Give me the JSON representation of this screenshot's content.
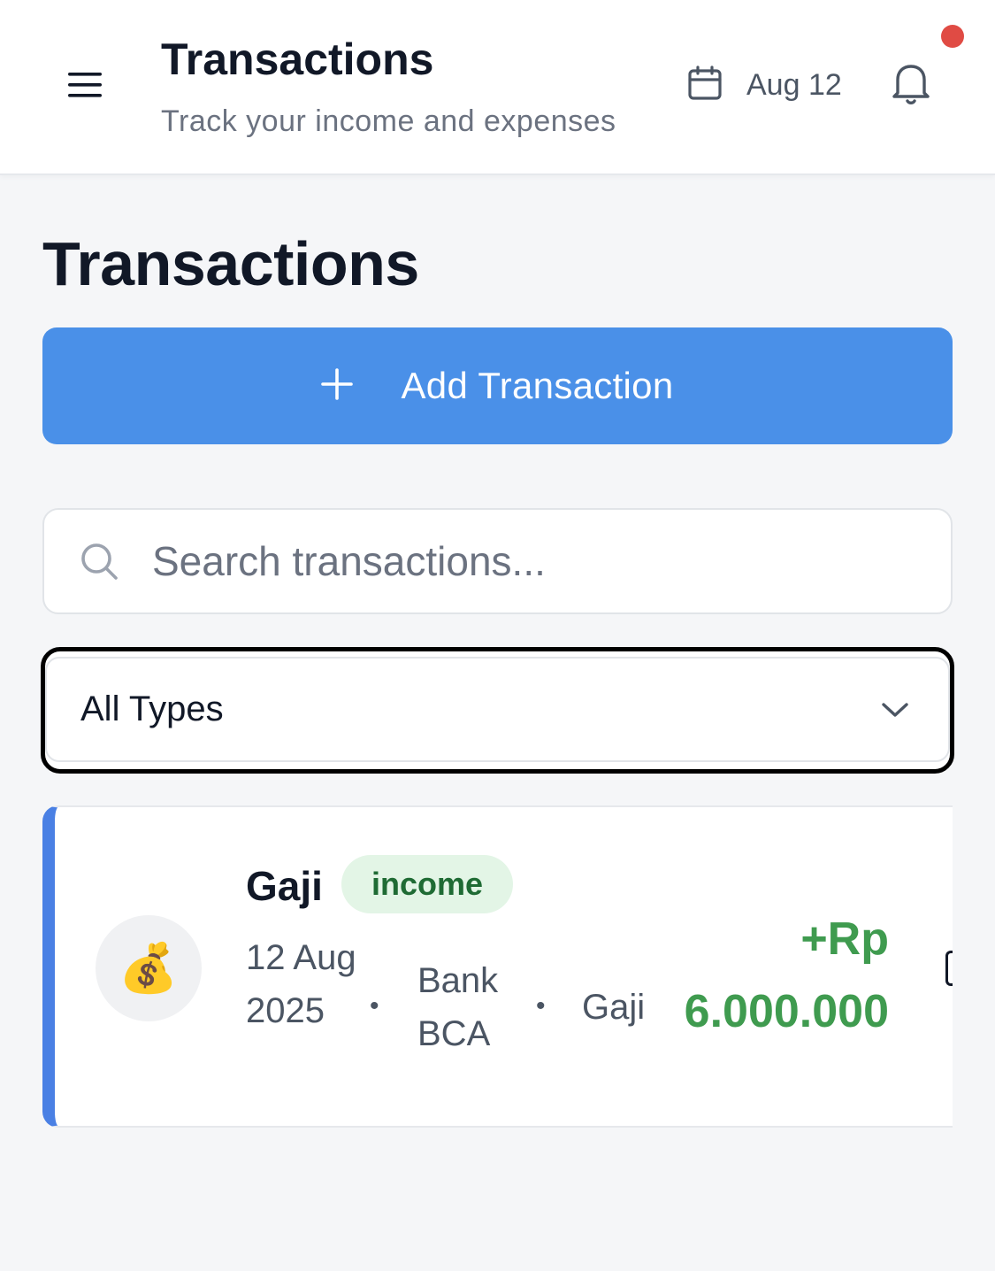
{
  "header": {
    "title": "Transactions",
    "subtitle": "Track your income and expenses",
    "date_label": "Aug 12",
    "icons": {
      "menu": "hamburger-menu-icon",
      "calendar": "calendar-icon",
      "notifications": "bell-icon"
    },
    "notification_dot_color": "#e04b44"
  },
  "page": {
    "title": "Transactions",
    "add_button": {
      "icon": "plus",
      "label": "Add Transaction",
      "color": "#4a90e8"
    },
    "search": {
      "placeholder": "Search transactions...",
      "value": ""
    },
    "type_filter": {
      "selected": "All Types"
    }
  },
  "transactions": [
    {
      "icon": "💰",
      "name": "Gaji",
      "type": "income",
      "date": "12 Aug 2025",
      "account": "Bank BCA",
      "category": "Gaji",
      "amount_prefix": "+Rp",
      "amount": "6.000.000",
      "amount_color": "#3f9b4f",
      "accent_color": "#4a80e4"
    }
  ]
}
